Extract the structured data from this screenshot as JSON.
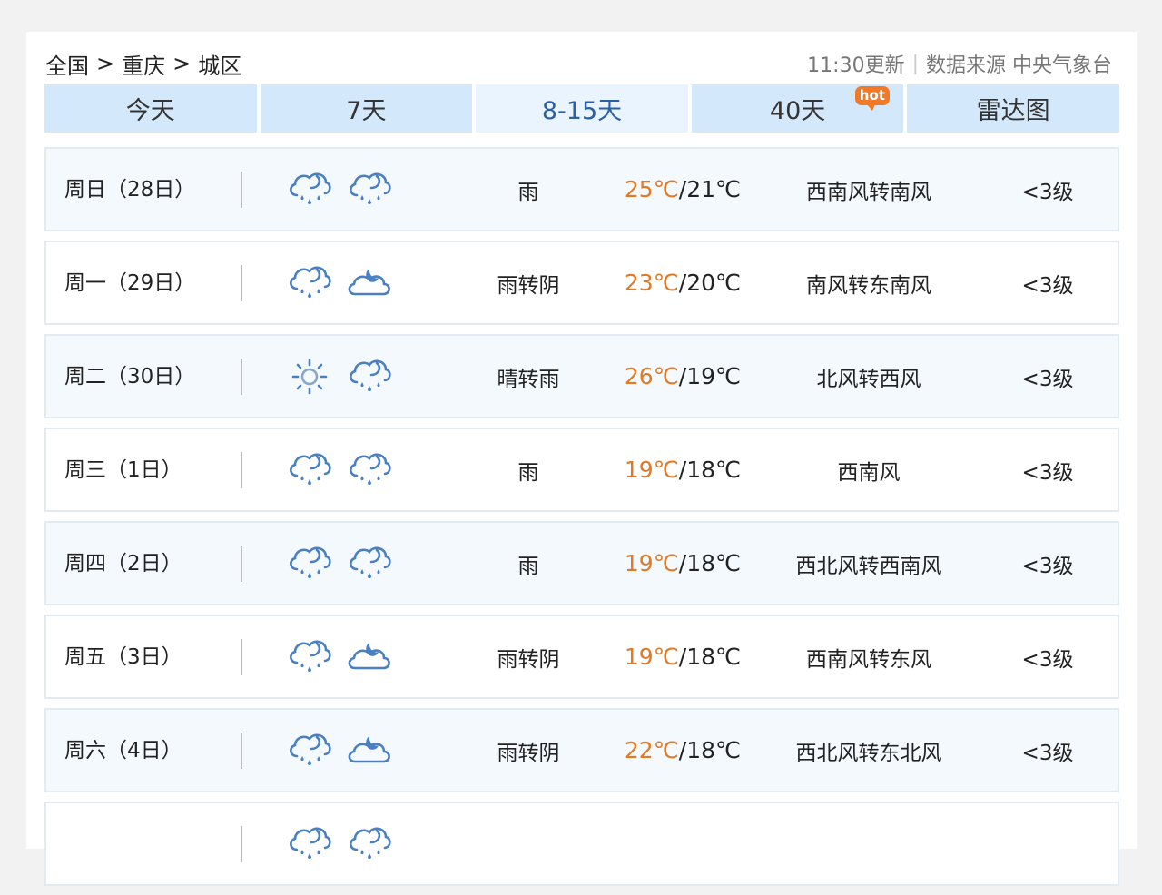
{
  "breadcrumb": {
    "items": [
      "全国",
      "重庆",
      "城区"
    ],
    "separator": ">"
  },
  "update": {
    "time_text": "11:30更新",
    "source_text": "数据来源 中央气象台"
  },
  "tabs": [
    {
      "label": "今天",
      "active": false
    },
    {
      "label": "7天",
      "active": false
    },
    {
      "label": "8-15天",
      "active": true
    },
    {
      "label": "40天",
      "active": false,
      "badge": "hot"
    },
    {
      "label": "雷达图",
      "active": false
    }
  ],
  "colors": {
    "tab_bg": "#d4e8fb",
    "tab_active_bg": "#e9f4fe",
    "tab_active_text": "#2b5fa5",
    "high_temp": "#e07a28",
    "icon_blue": "#4a7fc1",
    "sun_color": "#8aa6c8",
    "hot_badge": "#f07a28"
  },
  "forecast": [
    {
      "date": "周日（28日）",
      "icons": [
        "rain-cloud-icon",
        "rain-cloud-icon"
      ],
      "desc": "雨",
      "high": "25℃",
      "low": "21℃",
      "wind": "西南风转南风",
      "level": "<3级"
    },
    {
      "date": "周一（29日）",
      "icons": [
        "rain-cloud-icon",
        "cloudy-night-icon"
      ],
      "desc": "雨转阴",
      "high": "23℃",
      "low": "20℃",
      "wind": "南风转东南风",
      "level": "<3级"
    },
    {
      "date": "周二（30日）",
      "icons": [
        "sun-icon",
        "rain-cloud-icon"
      ],
      "desc": "晴转雨",
      "high": "26℃",
      "low": "19℃",
      "wind": "北风转西风",
      "level": "<3级"
    },
    {
      "date": "周三（1日）",
      "icons": [
        "rain-cloud-icon",
        "rain-cloud-icon"
      ],
      "desc": "雨",
      "high": "19℃",
      "low": "18℃",
      "wind": "西南风",
      "level": "<3级"
    },
    {
      "date": "周四（2日）",
      "icons": [
        "rain-cloud-icon",
        "rain-cloud-icon"
      ],
      "desc": "雨",
      "high": "19℃",
      "low": "18℃",
      "wind": "西北风转西南风",
      "level": "<3级"
    },
    {
      "date": "周五（3日）",
      "icons": [
        "rain-cloud-icon",
        "cloudy-night-icon"
      ],
      "desc": "雨转阴",
      "high": "19℃",
      "low": "18℃",
      "wind": "西南风转东风",
      "level": "<3级"
    },
    {
      "date": "周六（4日）",
      "icons": [
        "rain-cloud-icon",
        "cloudy-night-icon"
      ],
      "desc": "雨转阴",
      "high": "22℃",
      "low": "18℃",
      "wind": "西北风转东北风",
      "level": "<3级"
    },
    {
      "date": "",
      "icons": [
        "rain-cloud-icon",
        "rain-cloud-icon"
      ],
      "desc": "",
      "high": "",
      "low": "",
      "wind": "",
      "level": ""
    }
  ]
}
